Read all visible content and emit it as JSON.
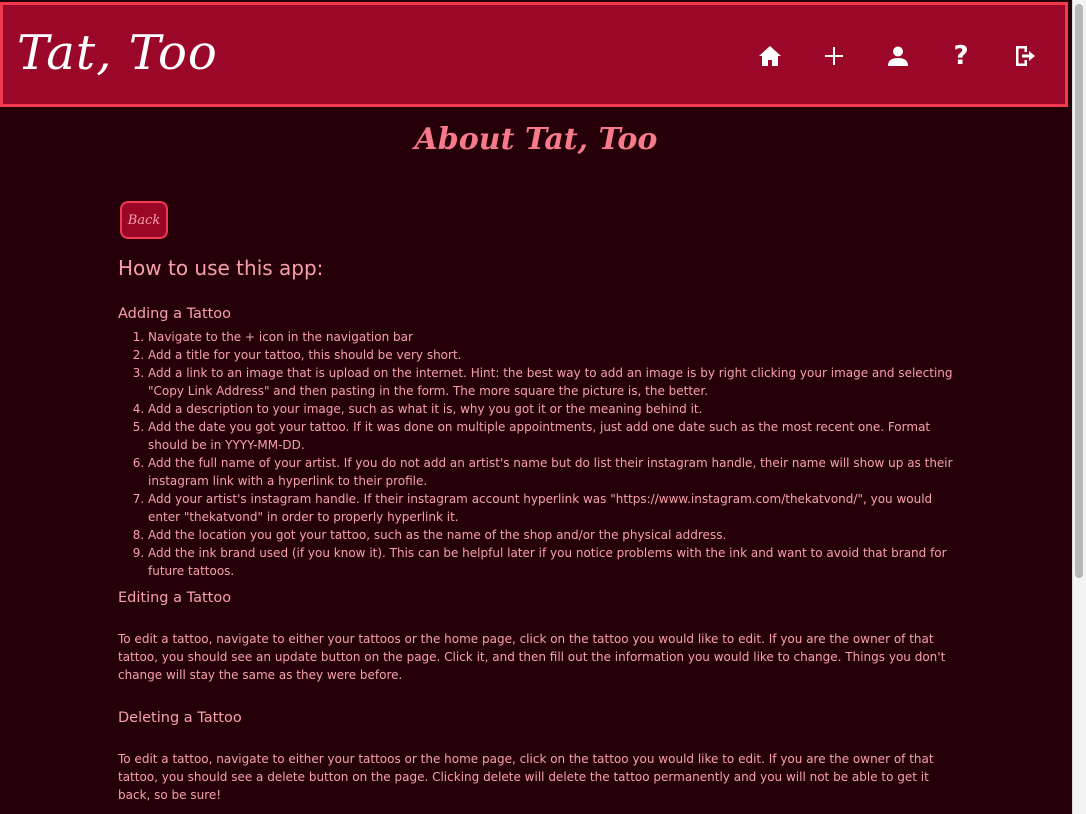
{
  "nav": {
    "brand": "Tat, Too",
    "icons": [
      "home-icon",
      "plus-icon",
      "user-icon",
      "help-icon",
      "logout-icon"
    ],
    "help_glyph": "?"
  },
  "page": {
    "title": "About Tat, Too",
    "back_label": "Back",
    "heading": "How to use this app:"
  },
  "sections": {
    "adding": {
      "title": "Adding a Tattoo",
      "steps": [
        "Navigate to the + icon in the navigation bar",
        "Add a title for your tattoo, this should be very short.",
        "Add a link to an image that is upload on the internet. Hint: the best way to add an image is by right clicking your image and selecting \"Copy Link Address\" and then pasting in the form. The more square the picture is, the better.",
        "Add a description to your image, such as what it is, why you got it or the meaning behind it.",
        "Add the date you got your tattoo. If it was done on multiple appointments, just add one date such as the most recent one. Format should be in YYYY-MM-DD.",
        "Add the full name of your artist. If you do not add an artist's name but do list their instagram handle, their name will show up as their instagram link with a hyperlink to their profile.",
        "Add your artist's instagram handle. If their instagram account hyperlink was \"https://www.instagram.com/thekatvond/\", you would enter \"thekatvond\" in order to properly hyperlink it.",
        "Add the location you got your tattoo, such as the name of the shop and/or the physical address.",
        "Add the ink brand used (if you know it). This can be helpful later if you notice problems with the ink and want to avoid that brand for future tattoos."
      ]
    },
    "editing": {
      "title": "Editing a Tattoo",
      "text": "To edit a tattoo, navigate to either your tattoos or the home page, click on the tattoo you would like to edit. If you are the owner of that tattoo, you should see an update button on the page. Click it, and then fill out the information you would like to change. Things you don't change will stay the same as they were before."
    },
    "deleting": {
      "title": "Deleting a Tattoo",
      "text": "To edit a tattoo, navigate to either your tattoos or the home page, click on the tattoo you would like to edit. If you are the owner of that tattoo, you should see a delete button on the page. Clicking delete will delete the tattoo permanently and you will not be able to get it back, so be sure!"
    }
  },
  "colors": {
    "background": "#250008",
    "navbar": "#9a0729",
    "navbar_border": "#f23a4e",
    "text": "#f7a0ac",
    "title": "#f77a8a"
  }
}
